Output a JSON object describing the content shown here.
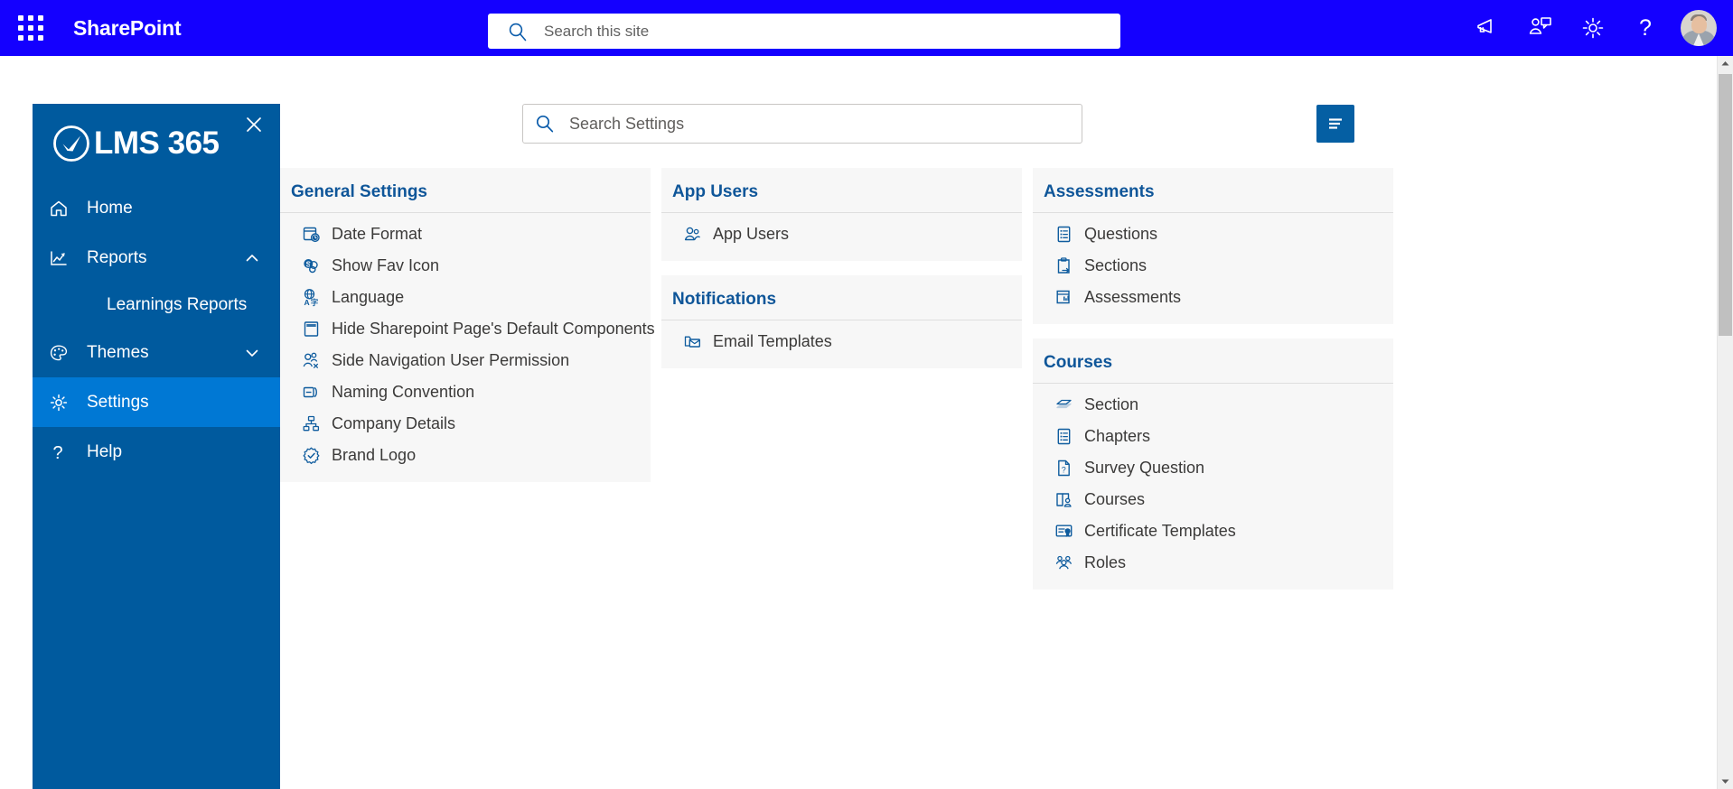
{
  "suitebar": {
    "waffle_label": "app-launcher",
    "brand": "SharePoint",
    "search_placeholder": "Search this site",
    "search_value": "",
    "icons": [
      {
        "name": "megaphone-icon",
        "label": "Announcements"
      },
      {
        "name": "chat-person-icon",
        "label": "Feedback"
      },
      {
        "name": "gear-icon",
        "label": "Settings"
      },
      {
        "name": "help-icon",
        "label": "Help"
      }
    ],
    "avatar_label": "User account"
  },
  "sidebar": {
    "close_label": "Close navigation",
    "logo_text": "LMS 365",
    "items": [
      {
        "label": "Home",
        "icon": "home-icon",
        "expandable": false,
        "selected": false
      },
      {
        "label": "Reports",
        "icon": "trend-chart-icon",
        "expandable": true,
        "expanded": true,
        "selected": false
      },
      {
        "label": "Themes",
        "icon": "palette-icon",
        "expandable": true,
        "expanded": false,
        "selected": false
      },
      {
        "label": "Settings",
        "icon": "gear-icon",
        "expandable": false,
        "selected": true
      },
      {
        "label": "Help",
        "icon": "question-mark-icon",
        "expandable": false,
        "selected": false
      }
    ],
    "reports_subitems": [
      {
        "label": "Learnings Reports"
      }
    ]
  },
  "toolbar": {
    "search_placeholder": "Search Settings",
    "search_value": "",
    "list_toggle_label": "Toggle list view"
  },
  "columns": [
    {
      "cards": [
        {
          "title": "General Settings",
          "items": [
            {
              "label": "Date Format",
              "icon": "calendar-clock-icon"
            },
            {
              "label": "Show Fav Icon",
              "icon": "sharepoint-fav-icon"
            },
            {
              "label": "Language",
              "icon": "globe-translate-icon"
            },
            {
              "label": "Hide Sharepoint Page's Default Components",
              "icon": "page-layout-icon"
            },
            {
              "label": "Side Navigation User Permission",
              "icon": "user-permission-icon"
            },
            {
              "label": "Naming Convention",
              "icon": "naming-tag-icon"
            },
            {
              "label": "Company Details",
              "icon": "org-hierarchy-icon"
            },
            {
              "label": "Brand Logo",
              "icon": "badge-check-icon"
            }
          ]
        }
      ]
    },
    {
      "cards": [
        {
          "title": "App Users",
          "items": [
            {
              "label": "App Users",
              "icon": "people-icon"
            }
          ]
        },
        {
          "title": "Notifications",
          "items": [
            {
              "label": "Email Templates",
              "icon": "email-template-icon"
            }
          ]
        }
      ]
    },
    {
      "cards": [
        {
          "title": "Assessments",
          "items": [
            {
              "label": "Questions",
              "icon": "list-bullet-icon"
            },
            {
              "label": "Sections",
              "icon": "clipboard-arrow-icon"
            },
            {
              "label": "Assessments",
              "icon": "report-grid-icon"
            }
          ]
        },
        {
          "title": "Courses",
          "items": [
            {
              "label": "Section",
              "icon": "stack-layers-icon"
            },
            {
              "label": "Chapters",
              "icon": "list-bullet-icon"
            },
            {
              "label": "Survey Question",
              "icon": "document-question-icon"
            },
            {
              "label": "Courses",
              "icon": "book-person-icon"
            },
            {
              "label": "Certificate Templates",
              "icon": "certificate-icon"
            },
            {
              "label": "Roles",
              "icon": "group-people-icon"
            }
          ]
        }
      ]
    }
  ],
  "scrollbar": {
    "vertical_label": "vertical-scrollbar"
  },
  "colors": {
    "suitebar_blue": "#1400ff",
    "nav_blue": "#005a9e",
    "nav_selected_blue": "#0078d4",
    "accent_header": "#0f5699",
    "button_blue": "#055fa3",
    "card_bg": "#f7f7f7"
  }
}
